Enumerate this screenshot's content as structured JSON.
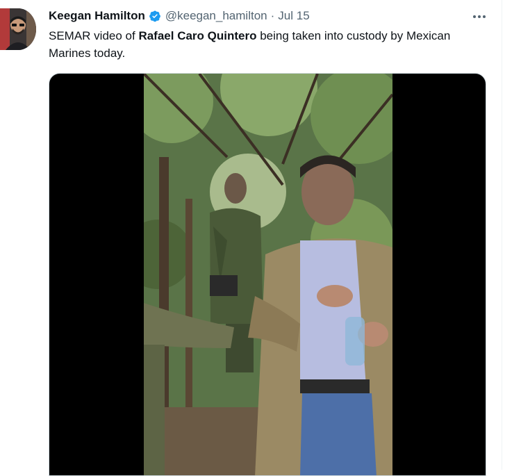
{
  "tweet": {
    "author_name": "Keegan Hamilton",
    "handle": "@keegan_hamilton",
    "separator": "·",
    "date": "Jul 15",
    "text_part1": "SEMAR video of ",
    "text_bold": "Rafael Caro Quintero",
    "text_part2": " being taken into custody by Mexican Marines today."
  },
  "icons": {
    "verified": "verified-badge-icon",
    "more": "more-options-icon"
  },
  "colors": {
    "accent": "#1d9bf0",
    "secondary_text": "#536471",
    "primary_text": "#0f1419"
  }
}
